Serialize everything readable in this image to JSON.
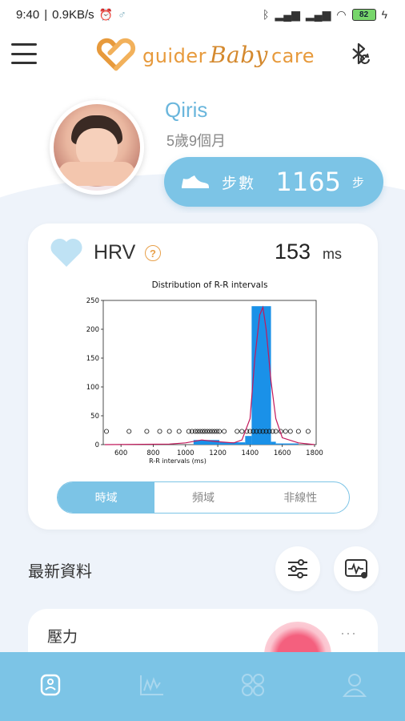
{
  "status_bar": {
    "time": "9:40",
    "network_speed": "0.9KB/s",
    "battery": "82"
  },
  "header": {
    "logo_left": "guider",
    "logo_mid": "Baby",
    "logo_right": "care",
    "icons": [
      "menu-icon",
      "bluetooth-sync-icon"
    ]
  },
  "profile": {
    "name": "Qiris",
    "age": "5歲9個月",
    "steps_label": "步數",
    "steps_value": "1165",
    "steps_unit": "步"
  },
  "hrv": {
    "title": "HRV",
    "help": "?",
    "value": "153",
    "unit": "ms",
    "tabs": [
      "時域",
      "頻域",
      "非線性"
    ],
    "active_tab": 0
  },
  "chart_data": {
    "type": "bar",
    "title": "Distribution of R-R intervals",
    "xlabel": "R-R intervals (ms)",
    "ylabel": "",
    "xlim": [
      490,
      1810
    ],
    "ylim": [
      0,
      250
    ],
    "x_ticks": [
      600,
      800,
      1000,
      1200,
      1400,
      1600,
      1800
    ],
    "y_ticks": [
      0,
      50,
      100,
      150,
      200,
      250
    ],
    "bins": [
      {
        "x0": 1050,
        "x1": 1210,
        "count": 8
      },
      {
        "x0": 1210,
        "x1": 1370,
        "count": 4
      },
      {
        "x0": 1370,
        "x1": 1410,
        "count": 15
      },
      {
        "x0": 1410,
        "x1": 1530,
        "count": 240
      },
      {
        "x0": 1530,
        "x1": 1560,
        "count": 5
      },
      {
        "x0": 1560,
        "x1": 1700,
        "count": 2
      }
    ],
    "density_curve": [
      [
        500,
        0
      ],
      [
        900,
        1
      ],
      [
        1000,
        3
      ],
      [
        1100,
        8
      ],
      [
        1200,
        5
      ],
      [
        1300,
        3
      ],
      [
        1350,
        8
      ],
      [
        1400,
        45
      ],
      [
        1430,
        150
      ],
      [
        1460,
        225
      ],
      [
        1480,
        238
      ],
      [
        1500,
        200
      ],
      [
        1530,
        110
      ],
      [
        1560,
        45
      ],
      [
        1600,
        12
      ],
      [
        1700,
        3
      ],
      [
        1800,
        0
      ]
    ],
    "rug_points": [
      510,
      650,
      760,
      840,
      900,
      960,
      1020,
      1040,
      1060,
      1075,
      1090,
      1105,
      1120,
      1135,
      1150,
      1165,
      1180,
      1195,
      1210,
      1240,
      1320,
      1350,
      1380,
      1400,
      1420,
      1440,
      1460,
      1480,
      1500,
      1520,
      1540,
      1560,
      1590,
      1620,
      1650,
      1700,
      1760
    ],
    "rug_y": 23,
    "colors": {
      "bar": "#1a91e8",
      "curve": "#c2185b"
    }
  },
  "latest": {
    "title": "最新資料",
    "pressure_title": "壓力",
    "more": "···"
  },
  "bottom_nav": {
    "items": [
      "watch-icon",
      "chart-icon",
      "apps-icon",
      "profile-icon"
    ],
    "active": 0
  },
  "colors": {
    "accent": "#7cc4e6",
    "logo": "#e79a3c",
    "background": "#eef3fa"
  }
}
